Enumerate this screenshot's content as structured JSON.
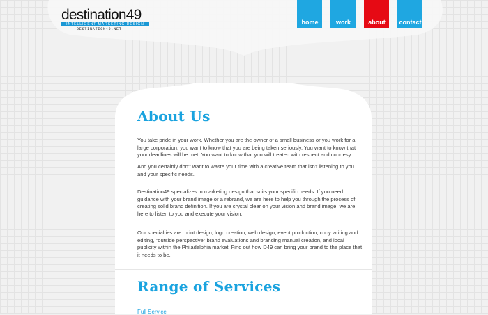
{
  "colors": {
    "accent": "#1fa7e1",
    "active": "#e60a14",
    "heading": "#1aa3df",
    "text": "#3a3a3a"
  },
  "logo": {
    "wordmark": "destination",
    "number": "49",
    "tagline": "INTELLIGENT MARKETING DESIGN",
    "url": "DESTINATION49.NET"
  },
  "nav": {
    "items": [
      {
        "label": "home",
        "active": false
      },
      {
        "label": "work",
        "active": false
      },
      {
        "label": "about",
        "active": true
      },
      {
        "label": "contact",
        "active": false
      }
    ]
  },
  "about": {
    "title": "About Us",
    "paragraphs": [
      "You take pride in your work. Whether you are the owner of a small business or you work for a large corporation, you want to know that you are being taken seriously. You want to know that your deadlines will be met. You want to know that you will treated with respect and courtesy.",
      "And you certainly don't want to waste your time with a creative team that isn't listening to you and your specific needs.",
      "Destination49 specializes in marketing design that suits your specific needs. If you need guidance with your brand image or a rebrand, we are here to help you through the process of creating solid brand definition. If you are crystal clear on your vision and brand image, we are here to listen to you and execute your vision.",
      "Our specialties are: print design, logo creation, web design, event production, copy writing and editing, \"outside perspective\" brand evaluations and branding manual creation, and local publicity within the Philadelphia market. Find out how D49 can bring your brand to the place that it needs to be."
    ]
  },
  "services": {
    "title": "Range of Services",
    "first_link": "Full Service"
  }
}
